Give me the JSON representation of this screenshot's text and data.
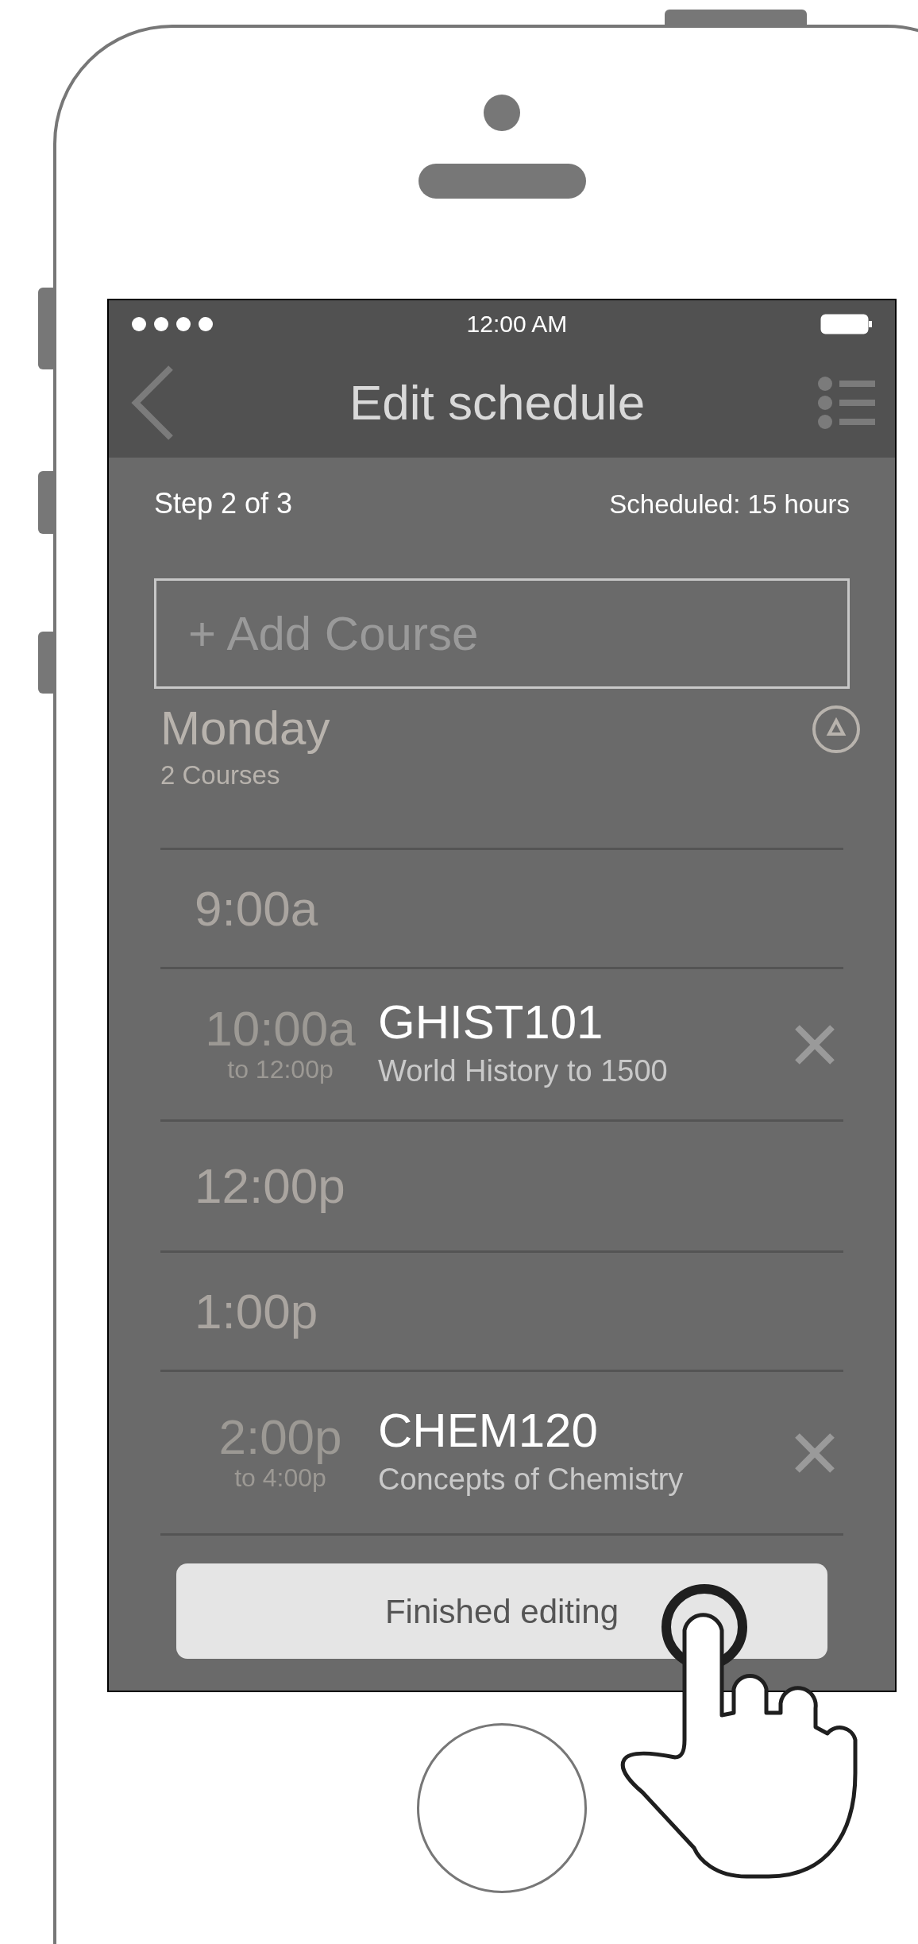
{
  "status_bar": {
    "time": "12:00 AM"
  },
  "header": {
    "title": "Edit schedule"
  },
  "summary": {
    "step": "Step 2 of 3",
    "scheduled": "Scheduled: 15 hours"
  },
  "add_course": {
    "placeholder": "+ Add Course"
  },
  "day": {
    "name": "Monday",
    "count": "2 Courses"
  },
  "rows": [
    {
      "kind": "empty",
      "time": "9:00a"
    },
    {
      "kind": "course",
      "time": "10:00a",
      "end": "to 12:00p",
      "code": "GHIST101",
      "name": "World History to 1500"
    },
    {
      "kind": "empty",
      "time": "12:00p"
    },
    {
      "kind": "empty",
      "time": "1:00p"
    },
    {
      "kind": "course",
      "time": "2:00p",
      "end": "to 4:00p",
      "code": "CHEM120",
      "name": "Concepts of Chemistry"
    }
  ],
  "finish_button": "Finished editing"
}
